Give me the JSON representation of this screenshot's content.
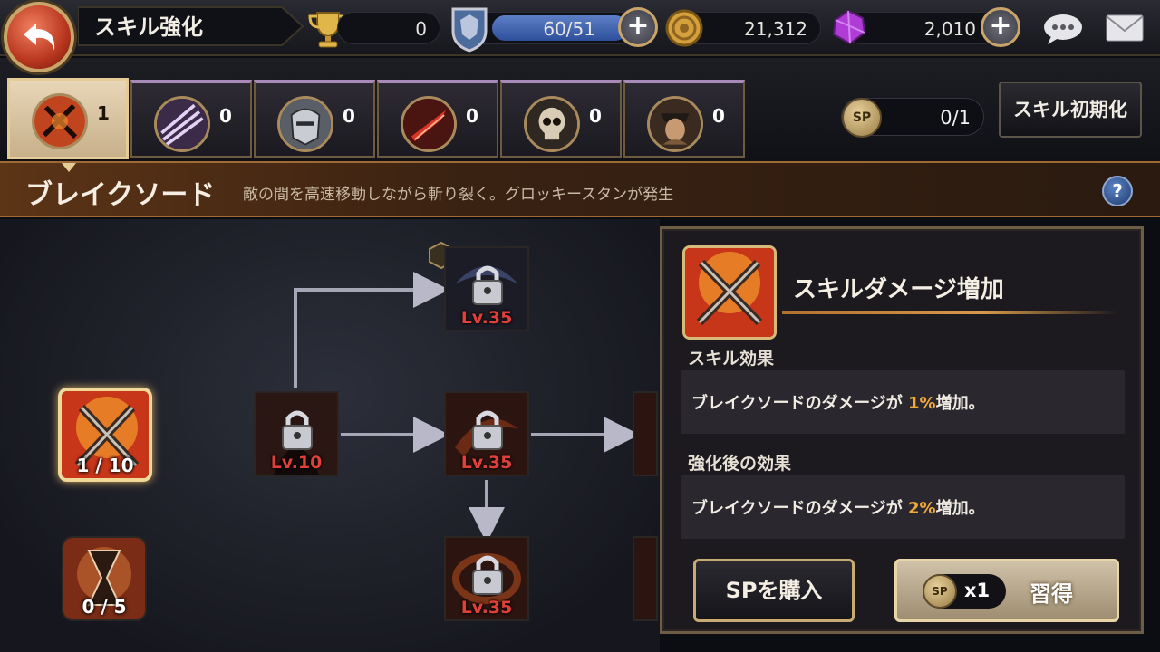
{
  "header": {
    "title": "スキル強化"
  },
  "resources": {
    "trophy": "0",
    "stamina": "60/51",
    "stamina_fill": 1.0,
    "gold": "21,312",
    "gems": "2,010"
  },
  "categories": [
    {
      "count": "1",
      "icon": "break-sword-icon",
      "active": true
    },
    {
      "count": "0",
      "icon": "claw-slash-icon"
    },
    {
      "count": "0",
      "icon": "helmet-icon"
    },
    {
      "count": "0",
      "icon": "red-blade-icon"
    },
    {
      "count": "0",
      "icon": "skull-icon"
    },
    {
      "count": "0",
      "icon": "warrior-portrait-icon"
    }
  ],
  "sp": {
    "label": "SP",
    "value": "0/1"
  },
  "reset_button": "スキル初期化",
  "skill": {
    "name": "ブレイクソード",
    "description": "敵の間を高速移動しながら斬り裂く。グロッキースタンが発生",
    "help": "?"
  },
  "tree": {
    "selected_node": {
      "level_text": "1 / 10"
    },
    "second_node": {
      "level_text": "0 / 5"
    },
    "locked": [
      "Lv.35",
      "Lv.10",
      "Lv.35",
      "Lv.35"
    ]
  },
  "detail": {
    "title": "スキルダメージ増加",
    "effect_label": "スキル効果",
    "effect_prefix": "ブレイクソードのダメージが",
    "effect_value": "1%",
    "effect_suffix": "増加。",
    "next_label": "強化後の効果",
    "next_prefix": "ブレイクソードのダメージが",
    "next_value": "2%",
    "next_suffix": "増加。",
    "buy_button": "SPを購入",
    "learn_cost": "x1",
    "learn_button": "習得"
  }
}
